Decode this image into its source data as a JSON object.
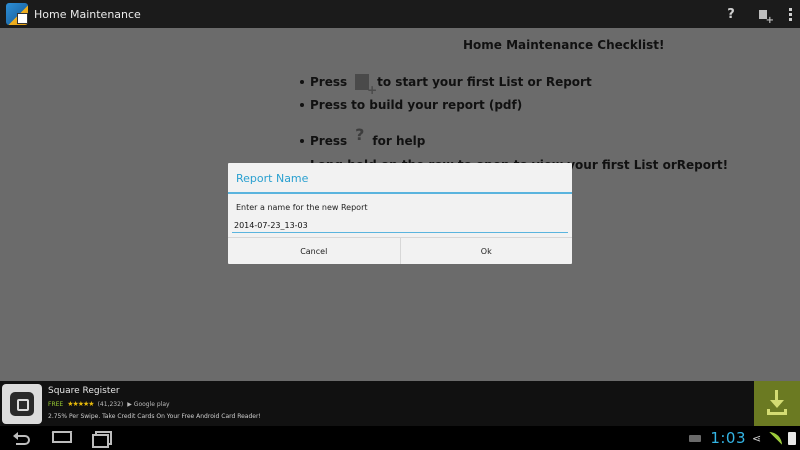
{
  "app": {
    "title": "Home Maintenance"
  },
  "action_bar": {
    "help_glyph": "?",
    "icons": [
      "help-icon",
      "add-list-icon",
      "overflow-menu-icon"
    ]
  },
  "content": {
    "heading": "Home Maintenance Checklist!",
    "lines": [
      {
        "before": "Press",
        "after": "to start your first List or Report"
      },
      {
        "before": "Press",
        "after": "to build your report (pdf)"
      },
      {
        "before": "Press",
        "after": "for help"
      },
      {
        "text": "Long hold on the row to open to view your first List orReport!"
      }
    ],
    "help_glyph": "?"
  },
  "dialog": {
    "title": "Report Name",
    "message": "Enter a name for the new Report",
    "input_value": "2014-07-23_13-03",
    "cancel_label": "Cancel",
    "ok_label": "Ok"
  },
  "ad": {
    "title": "Square Register",
    "price": "FREE",
    "stars": "★★★★★",
    "rating_count": "(41,232)",
    "store": "▶ Google play",
    "description": "2.75% Per Swipe. Take Credit Cards On Your Free Android Card Reader!"
  },
  "status_bar": {
    "time": "1:03"
  },
  "colors": {
    "accent": "#33b5e5",
    "dialog_title": "#2aa0d0",
    "download_bg": "#6b7a22",
    "dim_overlay": "#6b6b6b"
  }
}
